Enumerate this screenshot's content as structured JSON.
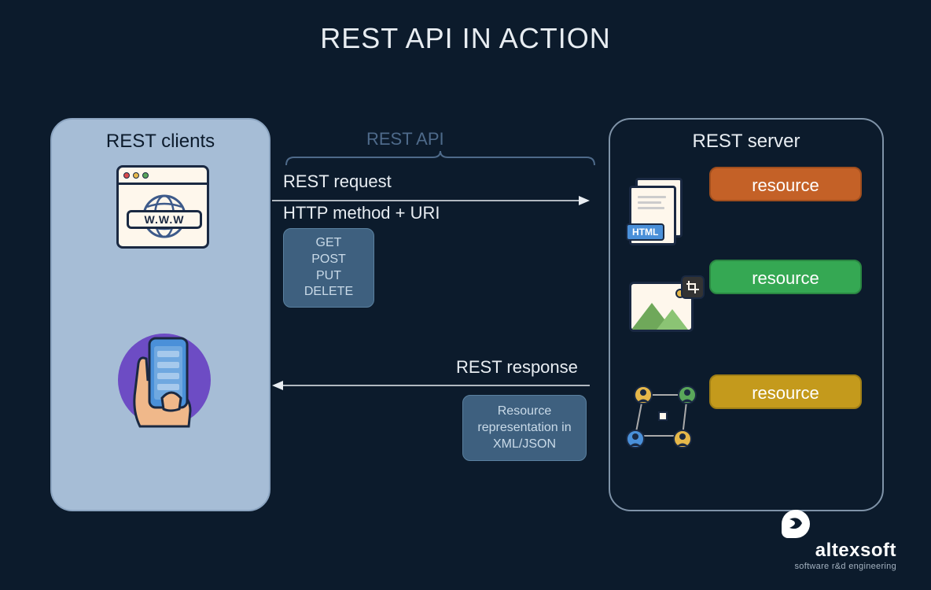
{
  "title": "REST API IN ACTION",
  "clients": {
    "heading": "REST clients",
    "www_label": "W.W.W"
  },
  "api": {
    "label": "REST API",
    "request_label": "REST request",
    "http_line": "HTTP method + URI",
    "methods": [
      "GET",
      "POST",
      "PUT",
      "DELETE"
    ],
    "response_label": "REST response",
    "representation": "Resource representation in XML/JSON"
  },
  "server": {
    "heading": "REST server",
    "html_badge": "HTML",
    "resources": [
      {
        "label": "resource",
        "color": "orange"
      },
      {
        "label": "resource",
        "color": "green"
      },
      {
        "label": "resource",
        "color": "yellow"
      }
    ]
  },
  "logo": {
    "name": "altexsoft",
    "tagline": "software r&d engineering"
  }
}
